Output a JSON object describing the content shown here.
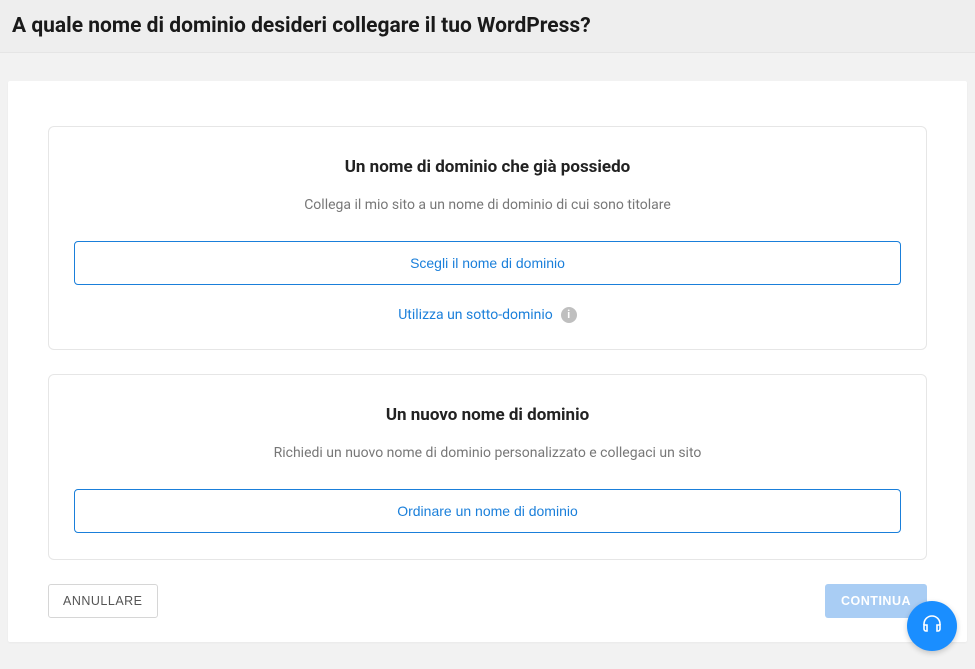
{
  "header": {
    "title": "A quale nome di dominio desideri collegare il tuo WordPress?"
  },
  "options": {
    "existing": {
      "title": "Un nome di dominio che già possiedo",
      "desc": "Collega il mio sito a un nome di dominio di cui sono titolare",
      "button": "Scegli il nome di dominio",
      "sub_link": "Utilizza un sotto-dominio"
    },
    "new": {
      "title": "Un nuovo nome di dominio",
      "desc": "Richiedi un nuovo nome di dominio personalizzato e collegaci un sito",
      "button": "Ordinare un nome di dominio"
    }
  },
  "footer": {
    "cancel": "ANNULLARE",
    "continue": "CONTINUA"
  }
}
